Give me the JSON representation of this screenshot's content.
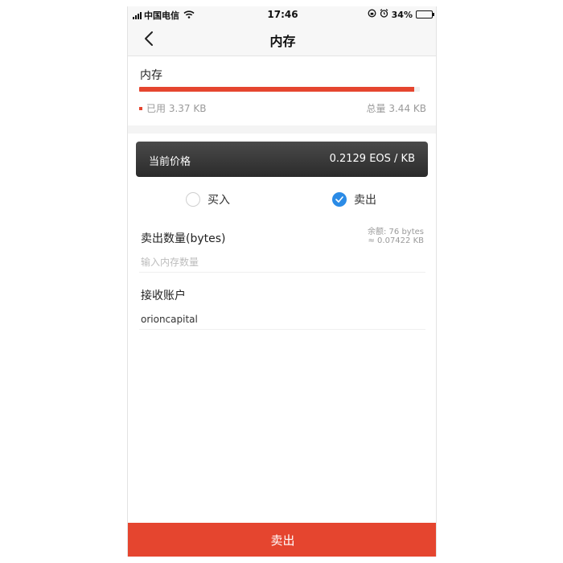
{
  "status_bar": {
    "carrier": "中国电信",
    "time": "17:46",
    "battery": "34%",
    "battery_level": 0.34
  },
  "nav": {
    "title": "内存"
  },
  "memory": {
    "title": "内存",
    "used_label": "已用 3.37 KB",
    "total_label": "总量 3.44 KB",
    "used_fraction": 0.98,
    "bar_color": "#e5452f"
  },
  "price": {
    "label": "当前价格",
    "value": "0.2129 EOS / KB"
  },
  "trade_type": {
    "buy_label": "买入",
    "sell_label": "卖出",
    "selected": "sell"
  },
  "amount": {
    "label": "卖出数量(bytes)",
    "placeholder": "输入内存数量",
    "balance_line1": "余额: 76 bytes",
    "balance_line2": "≈ 0.07422 KB"
  },
  "receiver": {
    "label": "接收账户",
    "value": "orioncapital"
  },
  "submit": {
    "label": "卖出"
  },
  "colors": {
    "accent": "#e5452f",
    "check": "#2b8be6",
    "card": "#333333"
  }
}
